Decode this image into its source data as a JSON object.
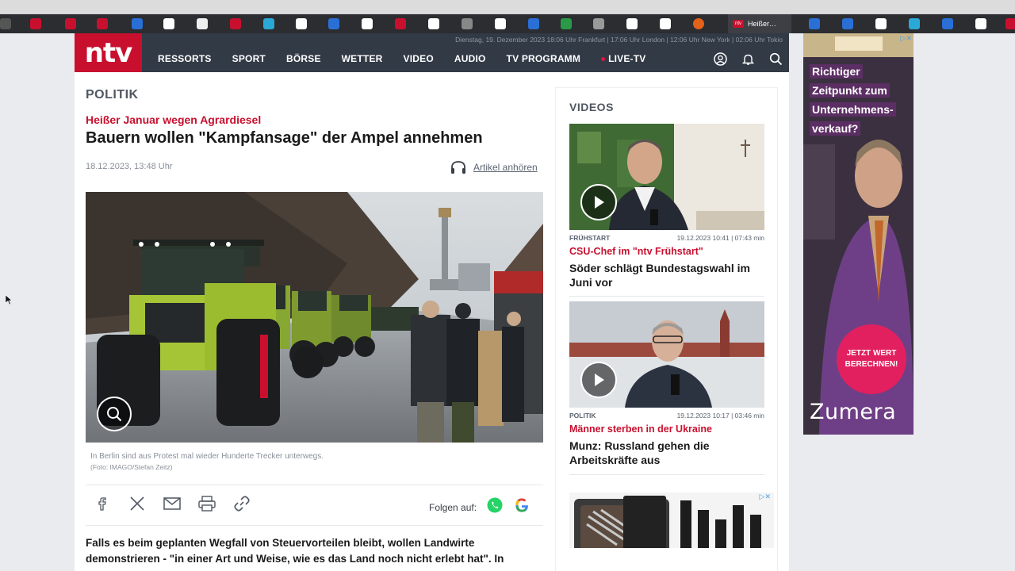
{
  "browser": {
    "active_tab_label": "Heißer…",
    "bookmark_icons": [
      "bookmark-icon",
      "bookmark-icon",
      "bookmark-icon",
      "bookmark-icon",
      "bookmark-icon",
      "bookmark-icon",
      "bookmark-icon",
      "bookmark-icon",
      "bookmark-icon",
      "bookmark-icon",
      "bookmark-icon",
      "bookmark-icon",
      "bookmark-icon",
      "bookmark-icon",
      "bookmark-icon",
      "bookmark-icon",
      "bookmark-icon",
      "bookmark-icon",
      "bookmark-icon",
      "bookmark-icon"
    ]
  },
  "header": {
    "logo": "ntv",
    "dateline": "Dienstag, 19. Dezember 2023 18:06 Uhr Frankfurt | 17:06 Uhr London | 12:06 Uhr New York | 02:06 Uhr Tokio",
    "nav": [
      "RESSORTS",
      "SPORT",
      "BÖRSE",
      "WETTER",
      "VIDEO",
      "AUDIO",
      "TV PROGRAMM",
      "LIVE-TV"
    ],
    "icons": [
      "user-icon",
      "bell-icon",
      "search-icon"
    ]
  },
  "article": {
    "ressort": "POLITIK",
    "kicker": "Heißer Januar wegen Agrardiesel",
    "headline": "Bauern wollen \"Kampfansage\" der Ampel annehmen",
    "date": "18.12.2023, 13:48 Uhr",
    "listen_label": "Artikel anhören",
    "caption": "In Berlin sind aus Protest mal wieder Hunderte Trecker unterwegs.",
    "credit": "(Foto: IMAGO/Stefan Zeitz)",
    "share_icons": [
      "facebook-icon",
      "x-icon",
      "mail-icon",
      "print-icon",
      "link-icon"
    ],
    "follow_label": "Folgen auf:",
    "follow_icons": [
      "whatsapp-icon",
      "google-icon"
    ],
    "lead": "Falls es beim geplanten Wegfall von Steuervorteilen bleibt, wollen Landwirte demonstrieren - \"in einer Art und Weise, wie es das Land noch nicht erlebt hat\". In"
  },
  "sidebar": {
    "title": "VIDEOS",
    "videos": [
      {
        "category": "FRÜHSTART",
        "datetime": "19.12.2023 10:41 | 07:43 min",
        "kicker": "CSU-Chef im \"ntv Frühstart\"",
        "title": "Söder schlägt Bundestagswahl im Juni vor"
      },
      {
        "category": "POLITIK",
        "datetime": "19.12.2023 10:17 | 03:46 min",
        "kicker": "Männer sterben in der Ukraine",
        "title": "Munz: Russland gehen die Arbeitskräfte aus"
      }
    ]
  },
  "ad": {
    "headline": [
      "Richtiger",
      "Zeitpunkt zum",
      "Unternehmens-",
      "verkauf?"
    ],
    "cta": "JETZT WERT BERECHNEN!",
    "brand": "Zumera"
  },
  "colors": {
    "brand_red": "#c8102e",
    "header_bg": "#323a46",
    "ad_cta": "#e2205f"
  }
}
